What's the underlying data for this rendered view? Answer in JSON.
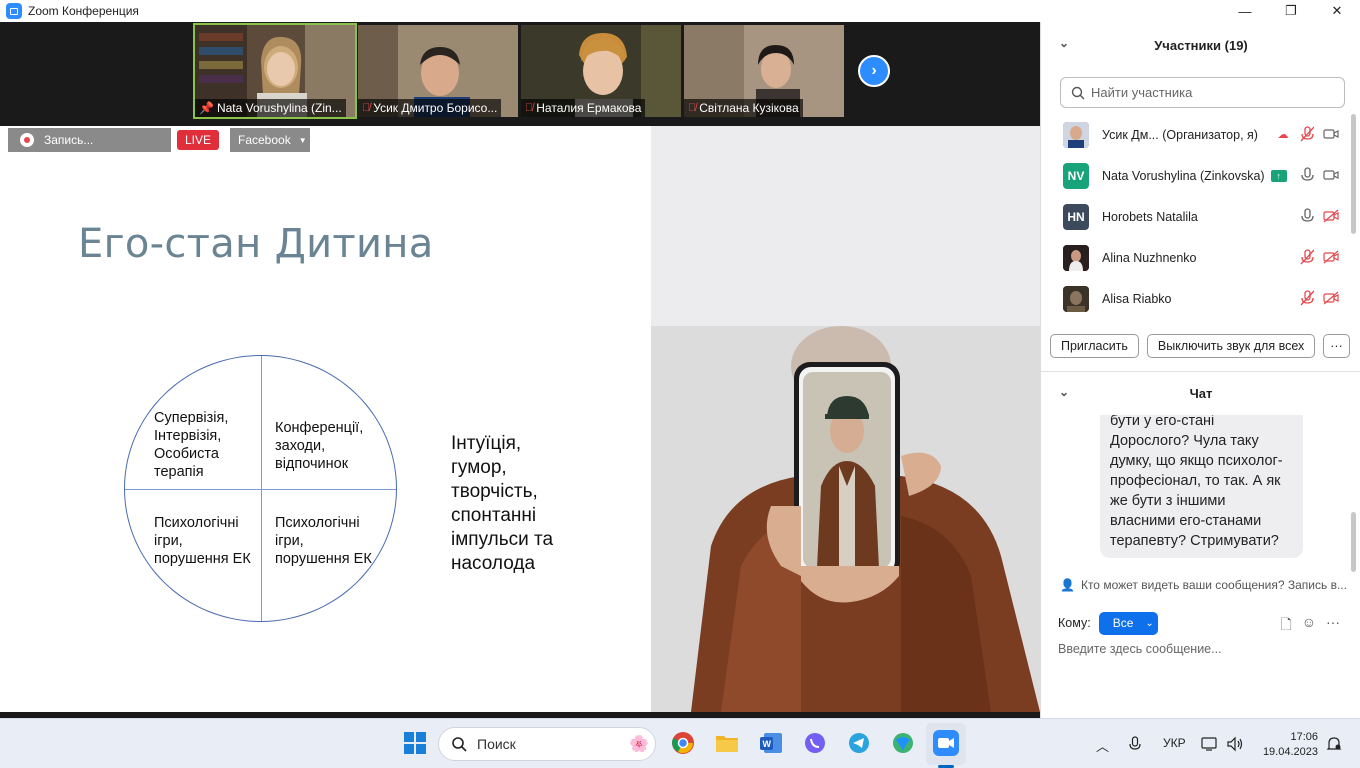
{
  "window": {
    "title": "Zoom Конференция"
  },
  "window_controls": {
    "minimize": "—",
    "maximize": "❐",
    "close": "✕"
  },
  "video_tiles": [
    {
      "name": "Nata Vorushylina (Zin...",
      "pinned": true,
      "muted": false
    },
    {
      "name": "Усик Дмитро Борисо...",
      "pinned": false,
      "muted": true
    },
    {
      "name": "Наталия Ермакова",
      "pinned": false,
      "muted": true
    },
    {
      "name": "Світлана Кузікова",
      "pinned": false,
      "muted": true
    }
  ],
  "recording": {
    "label": "Запись...",
    "live": "LIVE",
    "platform": "Facebook"
  },
  "slide": {
    "title": "Его-стан Дитина",
    "quadrants": {
      "top_left": "Супервізія,\nІнтервізія,\nОсобиста\nтерапія",
      "top_right": "Конференції,\nзаходи,\nвідпочинок",
      "bottom_left": "Психологічні\nігри,\nпорушення ЕК",
      "bottom_right": "Психологічні\nігри,\nпорушення ЕК"
    },
    "side_text": "Інтуїція,\nгумор,\nтворчість,\nспонтанні\nімпульси та\nнасолода"
  },
  "participants": {
    "header": "Участники (19)",
    "search_placeholder": "Найти участника",
    "list": [
      {
        "name": "Усик Дм... (Организатор, я)",
        "initials": "",
        "avatar_color": "#5b6b8c",
        "mic": "muted",
        "video": "on"
      },
      {
        "name": "Nata Vorushylina (Zinkovska)",
        "initials": "NV",
        "avatar_color": "#18a37b",
        "mic": "on",
        "video": "on"
      },
      {
        "name": "Horobets Natalila",
        "initials": "HN",
        "avatar_color": "#3d4a5c",
        "mic": "on",
        "video": "off"
      },
      {
        "name": "Alina Nuzhnenko",
        "initials": "",
        "avatar_color": "#3a2b2b",
        "mic": "muted",
        "video": "off"
      },
      {
        "name": "Alisa Riabko",
        "initials": "",
        "avatar_color": "#4a3a2a",
        "mic": "muted",
        "video": "off"
      }
    ],
    "invite_button": "Пригласить",
    "mute_all_button": "Выключить звук для всех",
    "more_button": "···"
  },
  "chat": {
    "header": "Чат",
    "message": "бути у его-стані Дорослого? Чула таку думку, що якщо психолог-професіонал, то так. А як же бути з іншими власними его-станами терапевту? Стримувати?",
    "who_note": "Кто может видеть ваши сообщения? Запись в...",
    "to_label": "Кому:",
    "to_value": "Все",
    "input_placeholder": "Введите здесь сообщение..."
  },
  "taskbar": {
    "search_label": "Поиск",
    "lang": "УКР",
    "time": "17:06",
    "date": "19.04.2023"
  },
  "colors": {
    "zoom_blue": "#2d8cff",
    "live_red": "#e02f3b",
    "mute_red": "#e5484d",
    "active_green": "#8bc34a"
  }
}
